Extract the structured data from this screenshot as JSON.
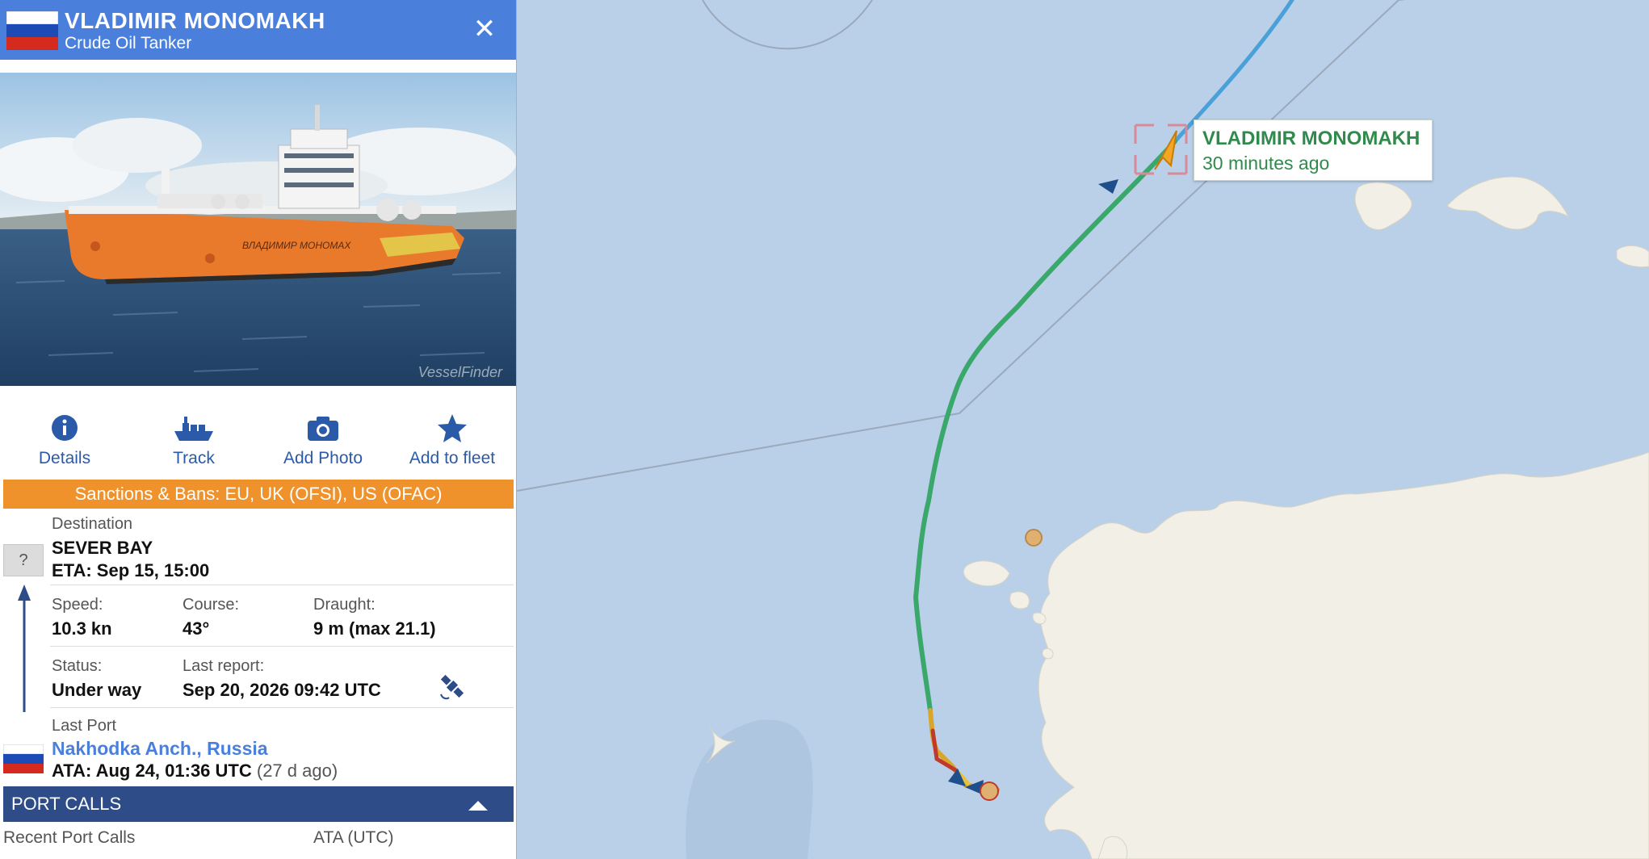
{
  "vessel": {
    "name": "VLADIMIR MONOMAKH",
    "type": "Crude Oil Tanker",
    "hull_name": "ВЛАДИМИР МОНОМАХ",
    "photo_watermark": "VesselFinder"
  },
  "actions": {
    "details": "Details",
    "track": "Track",
    "add_photo": "Add Photo",
    "add_to_fleet": "Add to fleet"
  },
  "sanctions": "Sanctions & Bans: EU, UK (OFSI), US (OFAC)",
  "route": {
    "unknown_marker": "?",
    "destination_label": "Destination",
    "destination": "SEVER BAY",
    "eta": "ETA: Sep 15, 15:00"
  },
  "stats": {
    "speed_label": "Speed:",
    "speed": "10.3 kn",
    "course_label": "Course:",
    "course": "43°",
    "draught_label": "Draught:",
    "draught": "9 m (max 21.1)",
    "status_label": "Status:",
    "status": "Under way",
    "last_report_label": "Last report:",
    "last_report": "Sep 20, 2026 09:42 UTC"
  },
  "last_port": {
    "label": "Last Port",
    "name": "Nakhodka Anch., Russia",
    "ata": "ATA: Aug 24, 01:36 UTC",
    "ago": "(27 d ago)"
  },
  "port_calls": {
    "title": "PORT CALLS",
    "col_recent": "Recent Port Calls",
    "col_ata": "ATA (UTC)"
  },
  "map": {
    "label_name": "VLADIMIR MONOMAKH",
    "label_time": "30 minutes ago"
  },
  "colors": {
    "header": "#4a80dc",
    "sanctions": "#f0922b",
    "port_calls": "#2e4d88",
    "track": "#3aa86a",
    "sea": "#b9d0e8",
    "land": "#f2efe6"
  }
}
